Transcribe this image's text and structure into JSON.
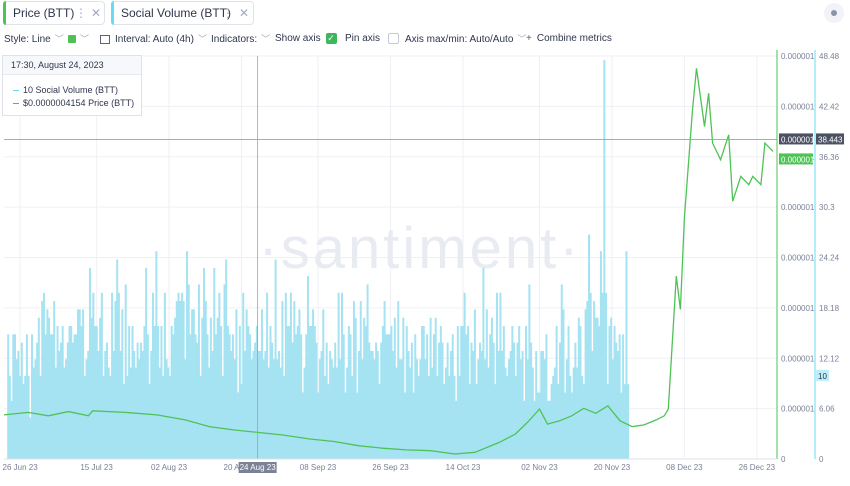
{
  "tabs": [
    {
      "label": "Price (BTT)",
      "color": "#4ec355"
    },
    {
      "label": "Social Volume (BTT)",
      "color": "#68dbf4"
    }
  ],
  "toolbar": {
    "style": "Style: Line",
    "interval": "Interval: Auto (4h)",
    "indicators": "Indicators:",
    "show_axis": "Show axis",
    "pin_axis": "Pin axis",
    "axis_maxmin": "Axis max/min: Auto/Auto",
    "combine": "Combine metrics"
  },
  "tooltip": {
    "date": "17:30, August 24, 2023",
    "rows": [
      {
        "value": "10",
        "label": "Social Volume (BTT)"
      },
      {
        "value": "$0.0000004154",
        "label": "Price (BTT)"
      }
    ]
  },
  "watermark": "santiment",
  "crosshair_date": "24 Aug 23",
  "colors": {
    "price": "#4ec355",
    "volume": "#a5e3f2",
    "volume_axis": "#68dbf4",
    "crosshair_badge": "#7b8296",
    "grid": "#eef0f4"
  },
  "chart_data": {
    "type": "line",
    "x_ticks": [
      "26 Jun 23",
      "15 Jul 23",
      "02 Aug 23",
      "20 Aug 23",
      "08 Sep 23",
      "26 Sep 23",
      "14 Oct 23",
      "02 Nov 23",
      "20 Nov 23",
      "08 Dec 23",
      "26 Dec 23"
    ],
    "x_range": [
      "2023-06-22",
      "2023-12-31"
    ],
    "price_axis": {
      "ticks": [
        "0",
        "0.000001",
        "0.000001",
        "0.000001",
        "0.000001",
        "0.000001",
        "0.000001",
        "0.000001",
        "0.000001"
      ],
      "current_label": "0.000001",
      "last_label": "0.000001"
    },
    "volume_axis": {
      "ticks": [
        0,
        6.06,
        12.12,
        18.18,
        24.24,
        30.3,
        36.36,
        42.42,
        48.48
      ],
      "current_label": "38.443",
      "last_label": "10"
    },
    "series": [
      {
        "name": "Social Volume (BTT)",
        "type": "bar",
        "axis": "volume",
        "start": "2023-06-23",
        "end": "2023-11-24",
        "values": [
          15,
          10,
          7,
          15,
          15,
          12,
          13,
          10,
          14,
          9,
          10,
          15,
          10,
          5,
          15,
          11,
          12,
          14,
          17,
          10,
          19,
          20,
          15,
          18,
          17,
          15,
          15,
          19,
          11,
          16,
          13,
          14,
          16,
          11,
          12,
          14,
          16,
          16,
          14,
          15,
          15,
          18,
          18,
          16,
          18,
          10,
          12,
          13,
          23,
          17,
          20,
          16,
          16,
          13,
          17,
          20,
          10,
          13,
          14,
          11,
          10,
          20,
          13,
          19,
          24,
          20,
          13,
          18,
          9,
          21,
          10,
          16,
          11,
          16,
          13,
          11,
          14,
          12,
          14,
          13,
          16,
          23,
          15,
          9,
          13,
          20,
          16,
          25,
          16,
          11,
          16,
          10,
          20,
          12,
          11,
          10,
          16,
          15,
          17,
          19,
          20,
          19,
          20,
          19,
          12,
          25,
          21,
          15,
          18,
          18,
          15,
          14,
          21,
          10,
          17,
          23,
          19,
          15,
          11,
          17,
          13,
          23,
          15,
          17,
          20,
          16,
          10,
          21,
          24,
          16,
          15,
          13,
          15,
          12,
          18,
          8,
          16,
          9,
          20,
          13,
          18,
          16,
          15,
          12,
          13,
          14,
          16,
          13,
          13,
          18,
          12,
          13,
          20,
          11,
          16,
          14,
          12,
          24,
          12,
          13,
          11,
          19,
          10,
          20,
          16,
          16,
          20,
          14,
          19,
          15,
          16,
          18,
          15,
          8,
          11,
          15,
          22,
          16,
          16,
          18,
          16,
          14,
          8,
          12,
          13,
          18,
          10,
          14,
          9,
          13,
          12,
          11,
          14,
          11,
          20,
          12,
          20,
          15,
          8,
          11,
          16,
          15,
          10,
          19,
          17,
          8,
          13,
          19,
          12,
          17,
          16,
          21,
          14,
          13,
          13,
          12,
          14,
          13,
          9,
          14,
          16,
          19,
          15,
          15,
          15,
          16,
          13,
          17,
          11,
          19,
          12,
          12,
          17,
          8,
          16,
          13,
          11,
          14,
          8,
          15,
          12,
          10,
          12,
          16,
          16,
          12,
          15,
          10,
          17,
          11,
          15,
          17,
          10,
          14,
          16,
          14,
          9,
          11,
          14,
          10,
          13,
          15,
          10,
          7,
          16,
          10,
          16,
          16,
          20,
          15,
          16,
          9,
          14,
          13,
          18,
          9,
          12,
          14,
          13,
          23,
          12,
          18,
          11,
          15,
          17,
          14,
          9,
          20,
          13,
          20,
          13,
          16,
          11,
          10,
          12,
          13,
          16,
          14,
          10,
          14,
          16,
          12,
          13,
          7,
          16,
          12,
          21,
          14,
          11,
          7,
          13,
          8,
          8,
          13,
          13,
          12,
          15,
          7,
          7,
          9,
          10,
          11,
          16,
          9,
          14,
          21,
          18,
          8,
          12,
          16,
          10,
          8,
          11,
          14,
          11,
          17,
          16,
          10,
          9,
          18,
          19,
          27,
          20,
          13,
          19,
          17,
          17,
          16,
          25,
          20,
          48,
          20,
          9,
          16,
          17,
          12,
          16,
          14,
          13,
          15,
          8,
          15,
          9,
          25,
          9
        ]
      },
      {
        "name": "Price (BTT)",
        "type": "line",
        "axis": "price",
        "x": [
          "2023-06-22",
          "2023-06-28",
          "2023-07-03",
          "2023-07-08",
          "2023-07-13",
          "2023-07-14",
          "2023-07-22",
          "2023-07-30",
          "2023-08-06",
          "2023-08-12",
          "2023-08-18",
          "2023-08-24",
          "2023-08-30",
          "2023-09-06",
          "2023-09-12",
          "2023-09-18",
          "2023-09-24",
          "2023-09-30",
          "2023-10-06",
          "2023-10-12",
          "2023-10-17",
          "2023-10-23",
          "2023-10-27",
          "2023-10-30",
          "2023-11-02",
          "2023-11-04",
          "2023-11-07",
          "2023-11-10",
          "2023-11-13",
          "2023-11-16",
          "2023-11-19",
          "2023-11-22",
          "2023-11-25",
          "2023-11-28",
          "2023-12-01",
          "2023-12-03",
          "2023-12-04",
          "2023-12-06",
          "2023-12-07",
          "2023-12-08",
          "2023-12-10",
          "2023-12-11",
          "2023-12-13",
          "2023-12-14",
          "2023-12-15",
          "2023-12-17",
          "2023-12-19",
          "2023-12-20",
          "2023-12-22",
          "2023-12-24",
          "2023-12-25",
          "2023-12-27",
          "2023-12-28",
          "2023-12-30"
        ],
        "values": [
          5.3,
          5.6,
          5.2,
          5.7,
          5.2,
          5.8,
          5.6,
          5.3,
          4.7,
          3.9,
          3.5,
          3.2,
          2.9,
          2.4,
          2.1,
          1.6,
          1.3,
          1.1,
          1.0,
          0.6,
          0.8,
          2.0,
          3.0,
          4.4,
          6.0,
          4.2,
          4.6,
          5.2,
          6.1,
          5.5,
          6.4,
          4.6,
          3.9,
          4.1,
          4.7,
          5.2,
          6.0,
          22.0,
          18.0,
          29.0,
          42.0,
          47.0,
          40.0,
          44.0,
          38.0,
          36.0,
          39.0,
          31.0,
          34.0,
          33.0,
          34.0,
          33.0,
          38.0,
          37.0
        ]
      }
    ]
  }
}
